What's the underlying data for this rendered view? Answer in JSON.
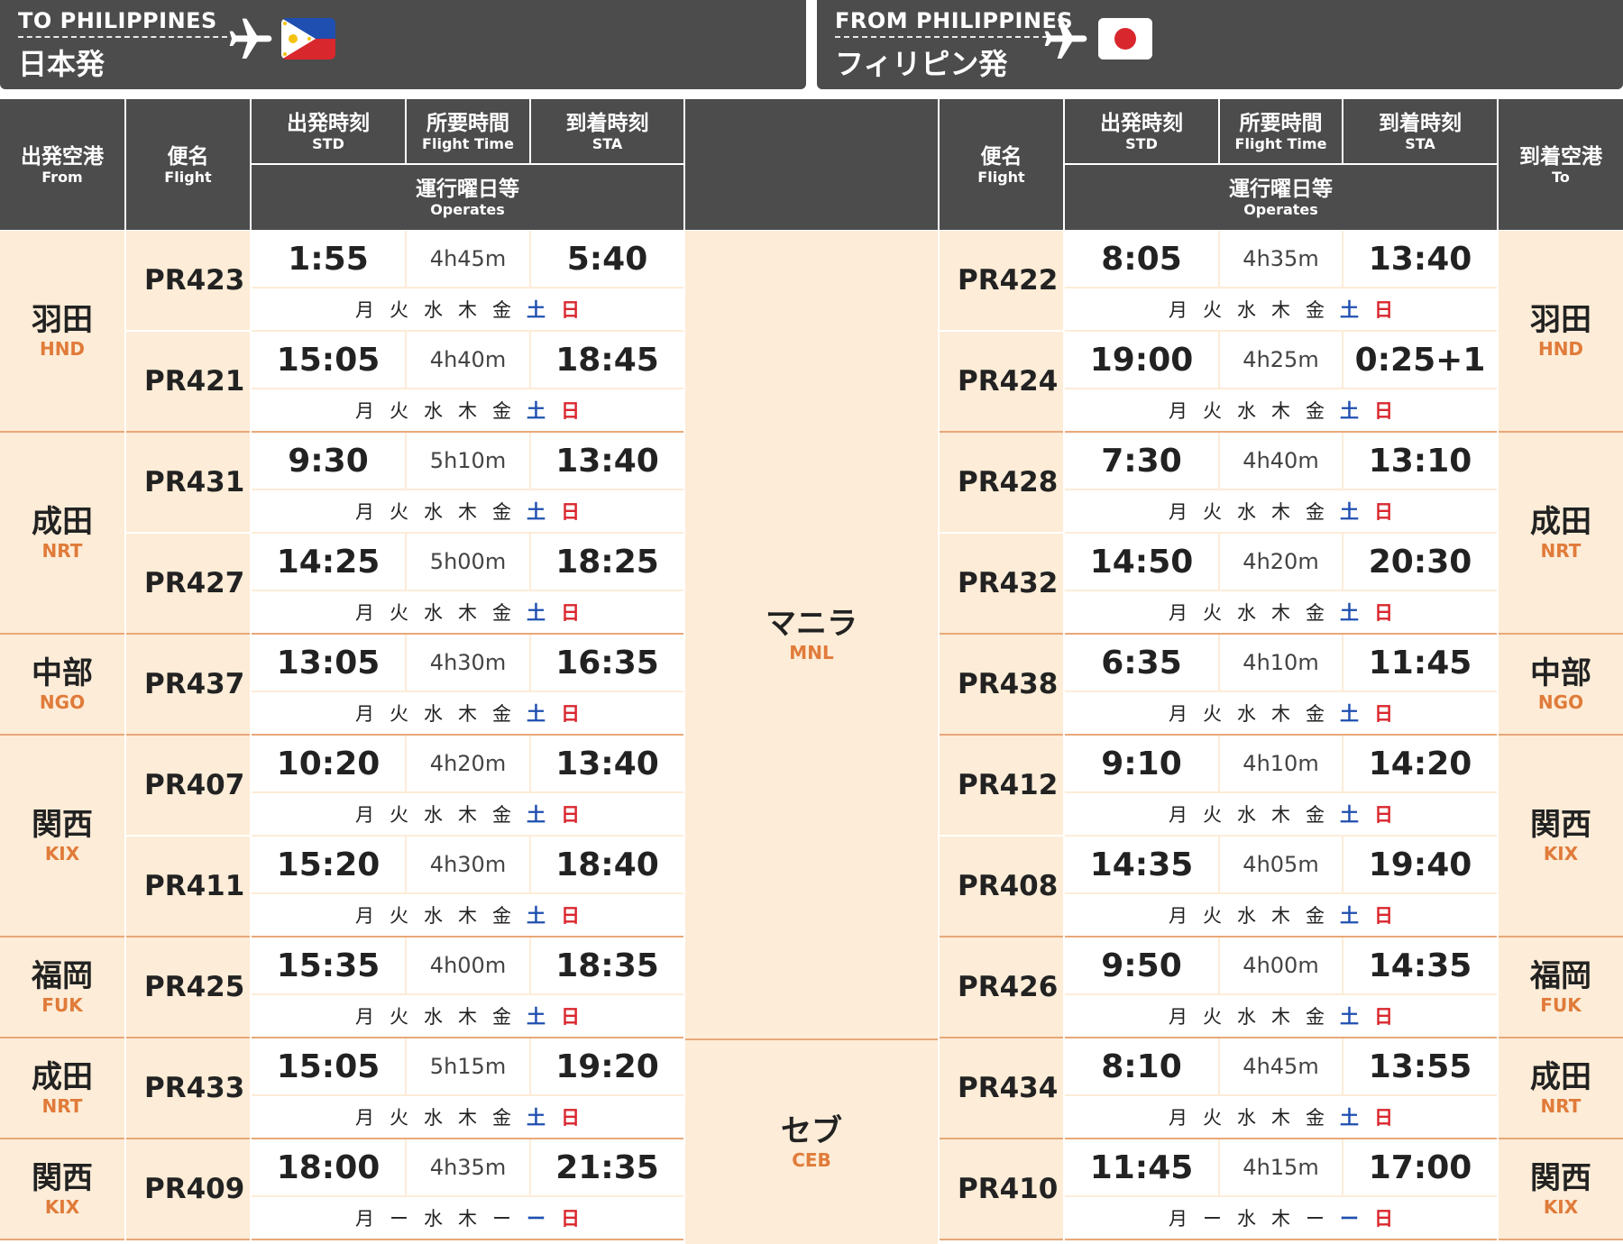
{
  "banner_left": {
    "en": "TO PHILIPPINES",
    "jp": "日本発",
    "flag": "philippines-flag"
  },
  "banner_right": {
    "en": "FROM PHILIPPINES",
    "jp": "フィリピン発",
    "flag": "japan-flag"
  },
  "colors": {
    "header_bg": "#4c4c4c",
    "cell_bg": "#fdecd7",
    "accent": "#e07b3a",
    "saturday": "#1f4fb0",
    "sunday": "#d9272e"
  },
  "headers": {
    "from": {
      "jp": "出発空港",
      "en": "From"
    },
    "flight": {
      "jp": "便名",
      "en": "Flight"
    },
    "std": {
      "jp": "出発時刻",
      "en": "STD"
    },
    "flight_time": {
      "jp": "所要時間",
      "en": "Flight Time"
    },
    "sta": {
      "jp": "到着時刻",
      "en": "STA"
    },
    "operates": {
      "jp": "運行曜日等",
      "en": "Operates"
    },
    "to": {
      "jp": "到着空港",
      "en": "To"
    }
  },
  "destinations": [
    {
      "jp": "マニラ",
      "en": "MNL"
    },
    {
      "jp": "セブ",
      "en": "CEB"
    }
  ],
  "airports": [
    {
      "jp": "羽田",
      "en": "HND"
    },
    {
      "jp": "成田",
      "en": "NRT"
    },
    {
      "jp": "中部",
      "en": "NGO"
    },
    {
      "jp": "関西",
      "en": "KIX"
    },
    {
      "jp": "福岡",
      "en": "FUK"
    },
    {
      "jp": "成田",
      "en": "NRT"
    },
    {
      "jp": "関西",
      "en": "KIX"
    }
  ],
  "outbound": [
    {
      "flight": "PR423",
      "std": "1:55",
      "duration": "4h45m",
      "sta": "5:40",
      "days": [
        "月",
        "火",
        "水",
        "木",
        "金",
        "土",
        "日"
      ]
    },
    {
      "flight": "PR421",
      "std": "15:05",
      "duration": "4h40m",
      "sta": "18:45",
      "days": [
        "月",
        "火",
        "水",
        "木",
        "金",
        "土",
        "日"
      ]
    },
    {
      "flight": "PR431",
      "std": "9:30",
      "duration": "5h10m",
      "sta": "13:40",
      "days": [
        "月",
        "火",
        "水",
        "木",
        "金",
        "土",
        "日"
      ]
    },
    {
      "flight": "PR427",
      "std": "14:25",
      "duration": "5h00m",
      "sta": "18:25",
      "days": [
        "月",
        "火",
        "水",
        "木",
        "金",
        "土",
        "日"
      ]
    },
    {
      "flight": "PR437",
      "std": "13:05",
      "duration": "4h30m",
      "sta": "16:35",
      "days": [
        "月",
        "火",
        "水",
        "木",
        "金",
        "土",
        "日"
      ]
    },
    {
      "flight": "PR407",
      "std": "10:20",
      "duration": "4h20m",
      "sta": "13:40",
      "days": [
        "月",
        "火",
        "水",
        "木",
        "金",
        "土",
        "日"
      ]
    },
    {
      "flight": "PR411",
      "std": "15:20",
      "duration": "4h30m",
      "sta": "18:40",
      "days": [
        "月",
        "火",
        "水",
        "木",
        "金",
        "土",
        "日"
      ]
    },
    {
      "flight": "PR425",
      "std": "15:35",
      "duration": "4h00m",
      "sta": "18:35",
      "days": [
        "月",
        "火",
        "水",
        "木",
        "金",
        "土",
        "日"
      ]
    },
    {
      "flight": "PR433",
      "std": "15:05",
      "duration": "5h15m",
      "sta": "19:20",
      "days": [
        "月",
        "火",
        "水",
        "木",
        "金",
        "土",
        "日"
      ]
    },
    {
      "flight": "PR409",
      "std": "18:00",
      "duration": "4h35m",
      "sta": "21:35",
      "days": [
        "月",
        "ー",
        "水",
        "木",
        "ー",
        "ー",
        "日"
      ]
    }
  ],
  "inbound": [
    {
      "flight": "PR422",
      "std": "8:05",
      "duration": "4h35m",
      "sta": "13:40",
      "days": [
        "月",
        "火",
        "水",
        "木",
        "金",
        "土",
        "日"
      ]
    },
    {
      "flight": "PR424",
      "std": "19:00",
      "duration": "4h25m",
      "sta": "0:25+1",
      "days": [
        "月",
        "火",
        "水",
        "木",
        "金",
        "土",
        "日"
      ]
    },
    {
      "flight": "PR428",
      "std": "7:30",
      "duration": "4h40m",
      "sta": "13:10",
      "days": [
        "月",
        "火",
        "水",
        "木",
        "金",
        "土",
        "日"
      ]
    },
    {
      "flight": "PR432",
      "std": "14:50",
      "duration": "4h20m",
      "sta": "20:30",
      "days": [
        "月",
        "火",
        "水",
        "木",
        "金",
        "土",
        "日"
      ]
    },
    {
      "flight": "PR438",
      "std": "6:35",
      "duration": "4h10m",
      "sta": "11:45",
      "days": [
        "月",
        "火",
        "水",
        "木",
        "金",
        "土",
        "日"
      ]
    },
    {
      "flight": "PR412",
      "std": "9:10",
      "duration": "4h10m",
      "sta": "14:20",
      "days": [
        "月",
        "火",
        "水",
        "木",
        "金",
        "土",
        "日"
      ]
    },
    {
      "flight": "PR408",
      "std": "14:35",
      "duration": "4h05m",
      "sta": "19:40",
      "days": [
        "月",
        "火",
        "水",
        "木",
        "金",
        "土",
        "日"
      ]
    },
    {
      "flight": "PR426",
      "std": "9:50",
      "duration": "4h00m",
      "sta": "14:35",
      "days": [
        "月",
        "火",
        "水",
        "木",
        "金",
        "土",
        "日"
      ]
    },
    {
      "flight": "PR434",
      "std": "8:10",
      "duration": "4h45m",
      "sta": "13:55",
      "days": [
        "月",
        "火",
        "水",
        "木",
        "金",
        "土",
        "日"
      ]
    },
    {
      "flight": "PR410",
      "std": "11:45",
      "duration": "4h15m",
      "sta": "17:00",
      "days": [
        "月",
        "ー",
        "水",
        "木",
        "ー",
        "ー",
        "日"
      ]
    }
  ]
}
